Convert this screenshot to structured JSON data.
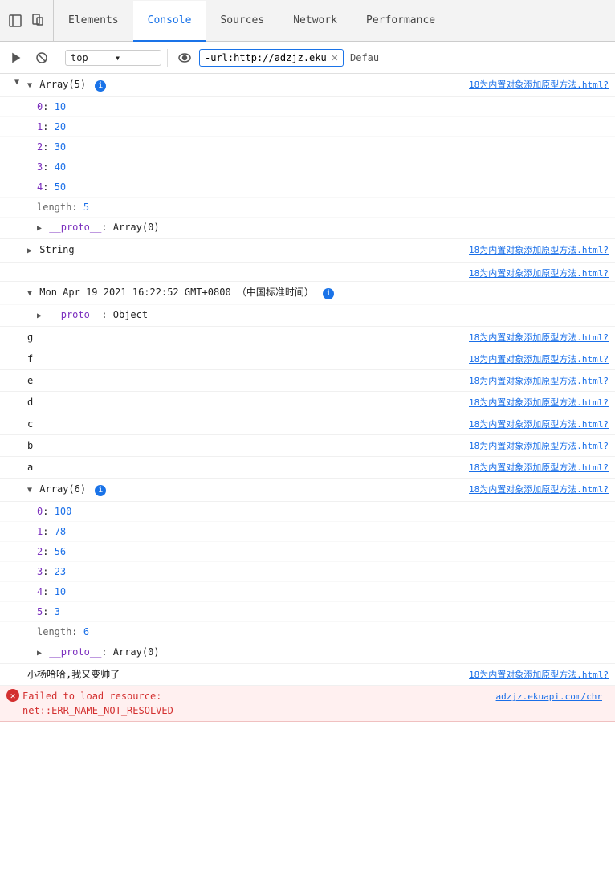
{
  "tabs": [
    {
      "id": "elements",
      "label": "Elements",
      "active": false
    },
    {
      "id": "console",
      "label": "Console",
      "active": true
    },
    {
      "id": "sources",
      "label": "Sources",
      "active": false
    },
    {
      "id": "network",
      "label": "Network",
      "active": false
    },
    {
      "id": "performance",
      "label": "Performance",
      "active": false
    }
  ],
  "toolbar": {
    "context": "top",
    "filter_value": "-url:http://adzjz.eku",
    "default_label": "Defau"
  },
  "console_rows": [
    {
      "type": "array_expanded",
      "label": "Array(5)",
      "has_info": true,
      "items": [
        {
          "key": "0",
          "val": "10"
        },
        {
          "key": "1",
          "val": "20"
        },
        {
          "key": "2",
          "val": "30"
        },
        {
          "key": "3",
          "val": "40"
        },
        {
          "key": "4",
          "val": "50"
        }
      ],
      "length": "5",
      "source": "18为内置对象添加原型方法.html?"
    },
    {
      "type": "object_collapsed",
      "label": "String",
      "source": "18为内置对象添加原型方法.html?"
    },
    {
      "type": "plain",
      "text": "",
      "source": "18为内置对象添加原型方法.html?"
    },
    {
      "type": "date_expanded",
      "label": "Mon Apr 19 2021 16:22:52 GMT+0800 （中国标准时间）",
      "has_info": true,
      "proto": "Object"
    },
    {
      "type": "plain",
      "text": "g",
      "source": "18为内置对象添加原型方法.html?"
    },
    {
      "type": "plain",
      "text": "f",
      "source": "18为内置对象添加原型方法.html?"
    },
    {
      "type": "plain",
      "text": "e",
      "source": "18为内置对象添加原型方法.html?"
    },
    {
      "type": "plain",
      "text": "d",
      "source": "18为内置对象添加原型方法.html?"
    },
    {
      "type": "plain",
      "text": "c",
      "source": "18为内置对象添加原型方法.html?"
    },
    {
      "type": "plain",
      "text": "b",
      "source": "18为内置对象添加原型方法.html?"
    },
    {
      "type": "plain",
      "text": "a",
      "source": "18为内置对象添加原型方法.html?"
    },
    {
      "type": "array_expanded2",
      "label": "Array(6)",
      "has_info": true,
      "items": [
        {
          "key": "0",
          "val": "100"
        },
        {
          "key": "1",
          "val": "78"
        },
        {
          "key": "2",
          "val": "56"
        },
        {
          "key": "3",
          "val": "23"
        },
        {
          "key": "4",
          "val": "10"
        },
        {
          "key": "5",
          "val": "3"
        }
      ],
      "length": "6",
      "source": "18为内置对象添加原型方法.html?"
    },
    {
      "type": "plain",
      "text": "小杨哈哈,我又变帅了",
      "source": "18为内置对象添加原型方法.html?"
    },
    {
      "type": "error",
      "text": "Failed to load resource:\nnet::ERR_NAME_NOT_RESOLVED",
      "source": "adzjz.ekuapi.com/chr"
    }
  ],
  "icons": {
    "cursor": "⬚",
    "device": "⬜",
    "play": "▶",
    "block": "⊘",
    "eye": "👁",
    "chevron": "▾",
    "close": "✕",
    "info": "i"
  }
}
